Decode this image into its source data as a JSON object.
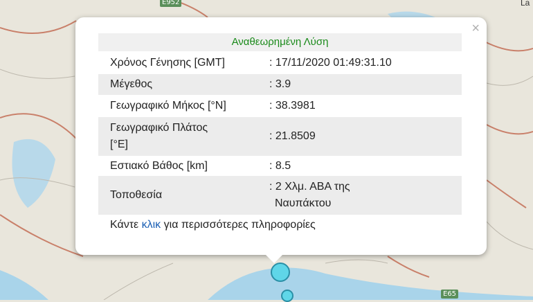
{
  "map": {
    "road_labels": [
      "E952",
      "E65"
    ],
    "place_label_partial": "La"
  },
  "popup": {
    "title": "Αναθεωρημένη Λύση",
    "close_glyph": "×",
    "rows": [
      {
        "label": "Χρόνος Γένησης [GMT]",
        "value": ": 17/11/2020 01:49:31.10"
      },
      {
        "label": "Μέγεθος",
        "value": ": 3.9"
      },
      {
        "label": "Γεωγραφικό Μήκος [°N]",
        "value": ": 38.3981"
      },
      {
        "label_line1": "Γεωγραφικό Πλάτος",
        "label_line2": "[°E]",
        "value": ": 21.8509"
      },
      {
        "label": "Εστιακό Βάθος [km]",
        "value": ": 8.5"
      },
      {
        "label": "Τοποθεσία",
        "value_line1": ": 2 Χλμ. ΑΒΑ της",
        "value_line2": "Ναυπάκτου"
      }
    ],
    "footer": {
      "before": "Κάντε ",
      "link": "κλικ",
      "after": " για περισσότερες πληροφορίες"
    }
  },
  "colors": {
    "title_green": "#1a8a1a",
    "link_blue": "#1a5fb4",
    "marker_fill": "#5fd6e8",
    "sea": "#a9d4ea",
    "land": "#e9e6dc",
    "border_road": "#c9806a"
  }
}
